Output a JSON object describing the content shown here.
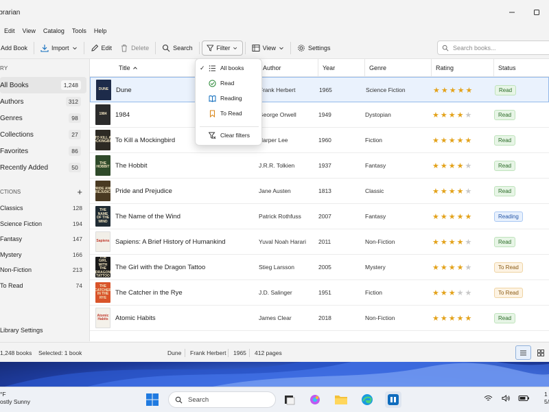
{
  "window": {
    "title": "ibrarian",
    "controls": [
      "minimize",
      "maximize"
    ]
  },
  "menu": [
    "Edit",
    "View",
    "Catalog",
    "Tools",
    "Help"
  ],
  "toolbar": {
    "add_book": "Add Book",
    "import": "Import",
    "edit": "Edit",
    "delete": "Delete",
    "search": "Search",
    "filter": "Filter",
    "view": "View",
    "settings": "Settings",
    "search_placeholder": "Search books..."
  },
  "sidebar": {
    "library_header": "RY",
    "items": [
      {
        "label": "All Books",
        "count": "1,248",
        "selected": true
      },
      {
        "label": "Authors",
        "count": "312"
      },
      {
        "label": "Genres",
        "count": "98"
      },
      {
        "label": "Collections",
        "count": "27"
      },
      {
        "label": "Favorites",
        "count": "86"
      },
      {
        "label": "Recently Added",
        "count": "50"
      }
    ],
    "collections_header": "CTIONS",
    "collections": [
      {
        "label": "Classics",
        "count": "128"
      },
      {
        "label": "Science Fiction",
        "count": "194"
      },
      {
        "label": "Fantasy",
        "count": "147"
      },
      {
        "label": "Mystery",
        "count": "166"
      },
      {
        "label": "Non-Fiction",
        "count": "213"
      },
      {
        "label": "To Read",
        "count": "74"
      }
    ],
    "footer": "Library Settings"
  },
  "table": {
    "columns": [
      "Title",
      "Author",
      "Year",
      "Genre",
      "Rating",
      "Status"
    ],
    "sort_column": "Title",
    "rows": [
      {
        "title": "Dune",
        "author": "Frank Herbert",
        "year": "1965",
        "genre": "Science Fiction",
        "rating": 5,
        "status": "Read",
        "cover_color": "#1d2b4a",
        "cover_text": "DUNE"
      },
      {
        "title": "1984",
        "author": "George Orwell",
        "year": "1949",
        "genre": "Dystopian",
        "rating": 4,
        "status": "Read",
        "cover_color": "#2b2b2b",
        "cover_text": "1984"
      },
      {
        "title": "To Kill a Mockingbird",
        "author": "Harper Lee",
        "year": "1960",
        "genre": "Fiction",
        "rating": 5,
        "status": "Read",
        "cover_color": "#2d2a24",
        "cover_text": "TO KILL A MOCKINGBIRD"
      },
      {
        "title": "The Hobbit",
        "author": "J.R.R. Tolkien",
        "year": "1937",
        "genre": "Fantasy",
        "rating": 4,
        "status": "Read",
        "cover_color": "#2f4a2a",
        "cover_text": "THE HOBBIT"
      },
      {
        "title": "Pride and Prejudice",
        "author": "Jane Austen",
        "year": "1813",
        "genre": "Classic",
        "rating": 4,
        "status": "Read",
        "cover_color": "#4a3a22",
        "cover_text": "PRIDE AND PREJUDICE"
      },
      {
        "title": "The Name of the Wind",
        "author": "Patrick Rothfuss",
        "year": "2007",
        "genre": "Fantasy",
        "rating": 5,
        "status": "Reading",
        "cover_color": "#1f2b33",
        "cover_text": "THE NAME OF THE WIND"
      },
      {
        "title": "Sapiens: A Brief History of Humankind",
        "author": "Yuval Noah Harari",
        "year": "2011",
        "genre": "Non-Fiction",
        "rating": 4,
        "status": "Read",
        "cover_color": "#f2efe8",
        "cover_text": "Sapiens"
      },
      {
        "title": "The Girl with the Dragon Tattoo",
        "author": "Stieg Larsson",
        "year": "2005",
        "genre": "Mystery",
        "rating": 4,
        "status": "To Read",
        "cover_color": "#1a1a1a",
        "cover_text": "THE GIRL WITH THE DRAGON TATTOO"
      },
      {
        "title": "The Catcher in the Rye",
        "author": "J.D. Salinger",
        "year": "1951",
        "genre": "Fiction",
        "rating": 3,
        "status": "To Read",
        "cover_color": "#d9542a",
        "cover_text": "THE CATCHER IN THE RYE"
      },
      {
        "title": "Atomic Habits",
        "author": "James Clear",
        "year": "2018",
        "genre": "Non-Fiction",
        "rating": 5,
        "status": "Read",
        "cover_color": "#f4f1ea",
        "cover_text": "Atomic Habits"
      }
    ]
  },
  "filter_menu": {
    "items": [
      {
        "label": "All books",
        "checked": true,
        "icon": "list-icon"
      },
      {
        "label": "Read",
        "icon": "check-circle-icon"
      },
      {
        "label": "Reading",
        "icon": "open-book-icon"
      },
      {
        "label": "To Read",
        "icon": "bookmark-icon"
      }
    ],
    "clear": "Clear filters"
  },
  "statusbar": {
    "total": "1,248 books",
    "selected": "Selected: 1 book",
    "sel_title": "Dune",
    "sel_author": "Frank Herbert",
    "sel_year": "1965",
    "sel_pages": "412 pages"
  },
  "taskbar": {
    "temp": "°F",
    "weather": "ostly Sunny",
    "search": "Search",
    "time": "1",
    "date": "5/"
  },
  "colors": {
    "accent": "#0f6cbd",
    "star": "#e3a21a",
    "selection": "#eaf2fd"
  }
}
